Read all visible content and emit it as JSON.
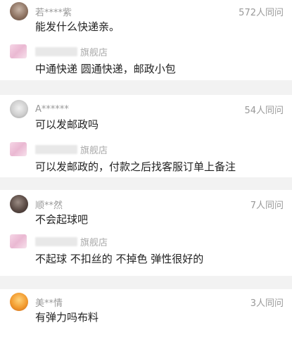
{
  "items": [
    {
      "name": "若****紫",
      "count": "572人同问",
      "question": "能发什么快递亲。",
      "shop_label": "旗舰店",
      "answer": "中通快递 圆通快递，邮政小包"
    },
    {
      "name": "A******",
      "count": "54人同问",
      "question": "可以发邮政吗",
      "shop_label": "旗舰店",
      "answer": "可以发邮政的，付款之后找客服订单上备注"
    },
    {
      "name": "顺**然",
      "count": "7人同问",
      "question": "不会起球吧",
      "shop_label": "旗舰店",
      "answer": "不起球 不扣丝的 不掉色 弹性很好的"
    },
    {
      "name": "美**情",
      "count": "3人同问",
      "question": "有弹力吗布料"
    }
  ]
}
